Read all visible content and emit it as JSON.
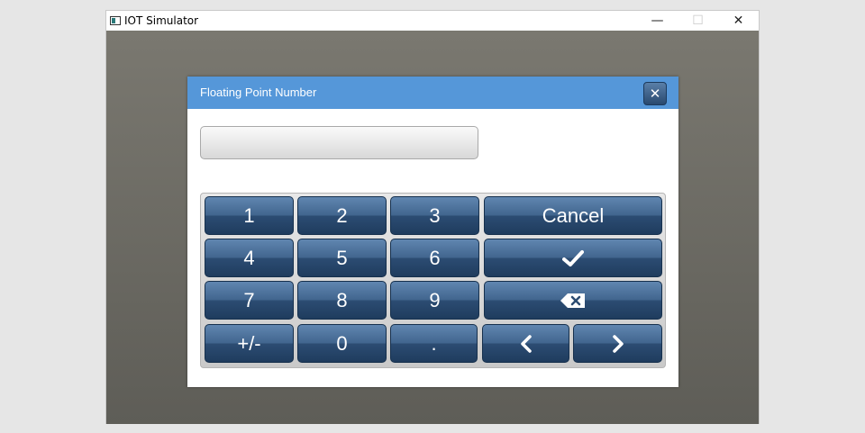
{
  "window": {
    "title": "IOT Simulator",
    "controls": {
      "minimize": "—",
      "maximize": "☐",
      "close": "✕"
    }
  },
  "dialog": {
    "title": "Floating Point Number",
    "close_label": "✕",
    "value": "",
    "header_color": "#5597d9"
  },
  "keypad": {
    "digits": [
      "1",
      "2",
      "3",
      "4",
      "5",
      "6",
      "7",
      "8",
      "9",
      "0"
    ],
    "plus_minus": "+/-",
    "decimal": ".",
    "cancel": "Cancel",
    "confirm_icon": "checkmark-icon",
    "backspace_icon": "backspace-icon",
    "left_icon": "chevron-left-icon",
    "right_icon": "chevron-right-icon",
    "key_color": "#2c4c72"
  }
}
